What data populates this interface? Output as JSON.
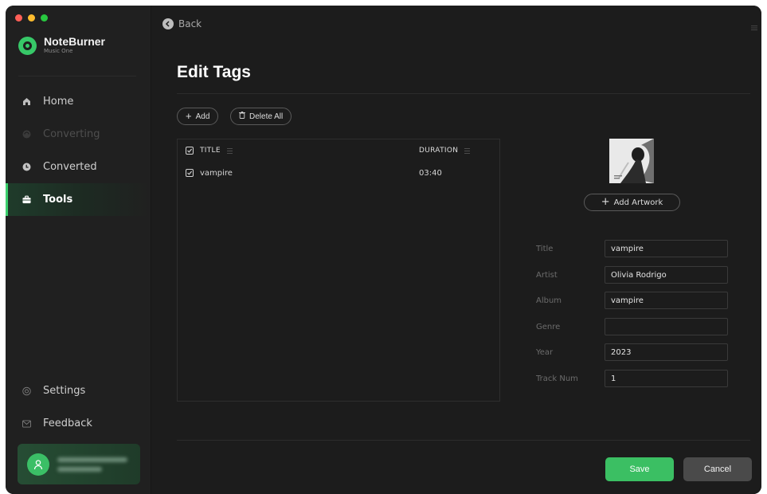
{
  "window": {
    "traffic_colors": [
      "#ff5f57",
      "#febc2e",
      "#28c840"
    ]
  },
  "sidebar": {
    "brand": {
      "name": "NoteBurner",
      "sub": "Music One"
    },
    "items": [
      {
        "label": "Home",
        "icon": "home-icon",
        "state": "normal"
      },
      {
        "label": "Converting",
        "icon": "converting-icon",
        "state": "disabled"
      },
      {
        "label": "Converted",
        "icon": "clock-icon",
        "state": "normal"
      },
      {
        "label": "Tools",
        "icon": "toolbox-icon",
        "state": "active"
      }
    ],
    "bottom_items": [
      {
        "label": "Settings",
        "icon": "gear-icon"
      },
      {
        "label": "Feedback",
        "icon": "mail-icon"
      }
    ],
    "accent": "#3bd06d"
  },
  "header": {
    "back_label": "Back"
  },
  "main": {
    "title": "Edit Tags",
    "add_label": "Add",
    "delete_all_label": "Delete All",
    "table": {
      "columns": [
        "TITLE",
        "DURATION"
      ],
      "rows": [
        {
          "title": "vampire",
          "duration": "03:40",
          "checked": true
        }
      ]
    },
    "add_artwork_label": "Add Artwork",
    "fields": [
      {
        "label": "Title",
        "value": "vampire"
      },
      {
        "label": "Artist",
        "value": "Olivia Rodrigo"
      },
      {
        "label": "Album",
        "value": "vampire"
      },
      {
        "label": "Genre",
        "value": ""
      },
      {
        "label": "Year",
        "value": "2023"
      },
      {
        "label": "Track Num",
        "value": "1"
      }
    ]
  },
  "footer": {
    "save_label": "Save",
    "cancel_label": "Cancel",
    "save_color": "#3bbf63"
  }
}
